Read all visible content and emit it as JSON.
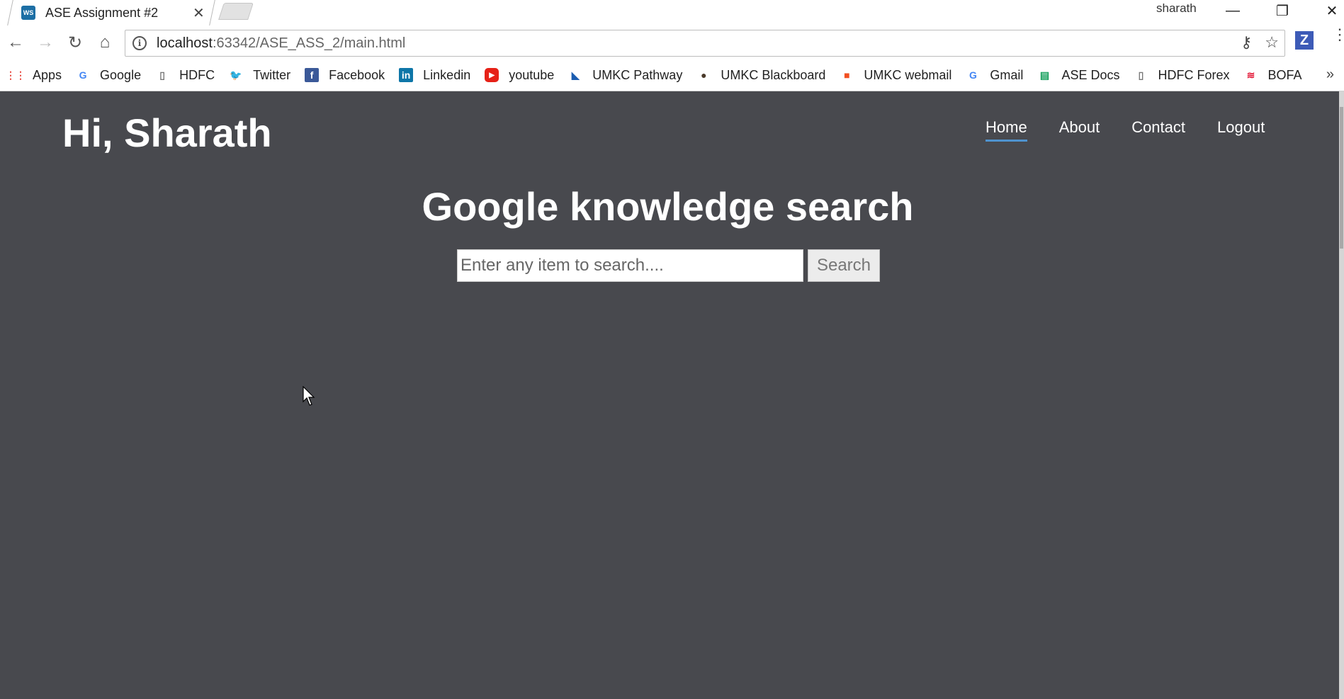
{
  "browser": {
    "tab_title": "ASE Assignment #2",
    "tab_icon": "WS",
    "profile_name": "sharath",
    "url_host": "localhost",
    "url_path": ":63342/ASE_ASS_2/main.html",
    "extension_label": "Z"
  },
  "bookmarks": [
    {
      "label": "Apps",
      "icon": "apps-grid-icon",
      "color": "#e8453c"
    },
    {
      "label": "Google",
      "icon": "google-icon",
      "color": "#4285f4"
    },
    {
      "label": "HDFC",
      "icon": "page-icon",
      "color": "#777777"
    },
    {
      "label": "Twitter",
      "icon": "twitter-icon",
      "color": "#1da1f2"
    },
    {
      "label": "Facebook",
      "icon": "facebook-icon",
      "color": "#3b5998"
    },
    {
      "label": "Linkedin",
      "icon": "linkedin-icon",
      "color": "#0e76a8"
    },
    {
      "label": "youtube",
      "icon": "youtube-icon",
      "color": "#e62117"
    },
    {
      "label": "UMKC Pathway",
      "icon": "umkc-pathway-icon",
      "color": "#1a5cb0"
    },
    {
      "label": "UMKC Blackboard",
      "icon": "blackboard-icon",
      "color": "#4a3a2a"
    },
    {
      "label": "UMKC webmail",
      "icon": "windows-icon",
      "color": "#f25022"
    },
    {
      "label": "Gmail",
      "icon": "google-icon",
      "color": "#4285f4"
    },
    {
      "label": "ASE Docs",
      "icon": "sheets-icon",
      "color": "#0f9d58"
    },
    {
      "label": "HDFC Forex",
      "icon": "page-icon",
      "color": "#777777"
    },
    {
      "label": "BOFA",
      "icon": "bofa-icon",
      "color": "#e31837"
    }
  ],
  "page": {
    "greeting": "Hi, Sharath",
    "nav": [
      {
        "label": "Home",
        "active": true
      },
      {
        "label": "About",
        "active": false
      },
      {
        "label": "Contact",
        "active": false
      },
      {
        "label": "Logout",
        "active": false
      }
    ],
    "headline": "Google knowledge search",
    "search_placeholder": "Enter any item to search....",
    "search_button": "Search"
  },
  "colors": {
    "page_background": "#48494e",
    "nav_underline": "#4f93ce"
  }
}
